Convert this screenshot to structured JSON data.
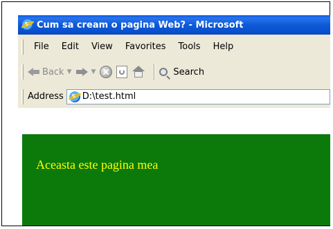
{
  "window": {
    "title": "Cum sa cream o pagina Web? - Microsoft"
  },
  "menubar": {
    "items": [
      {
        "label": "File"
      },
      {
        "label": "Edit"
      },
      {
        "label": "View"
      },
      {
        "label": "Favorites"
      },
      {
        "label": "Tools"
      },
      {
        "label": "Help"
      }
    ]
  },
  "toolbar": {
    "back_label": "Back",
    "search_label": "Search",
    "icons": [
      "back-arrow-icon",
      "forward-arrow-icon",
      "stop-icon",
      "refresh-icon",
      "home-icon",
      "search-icon"
    ]
  },
  "addressbar": {
    "label": "Address",
    "value": "D:\\test.html"
  },
  "page": {
    "text": "Aceasta este pagina mea",
    "background_color": "#0b7a0b",
    "text_color": "#ffff00"
  }
}
